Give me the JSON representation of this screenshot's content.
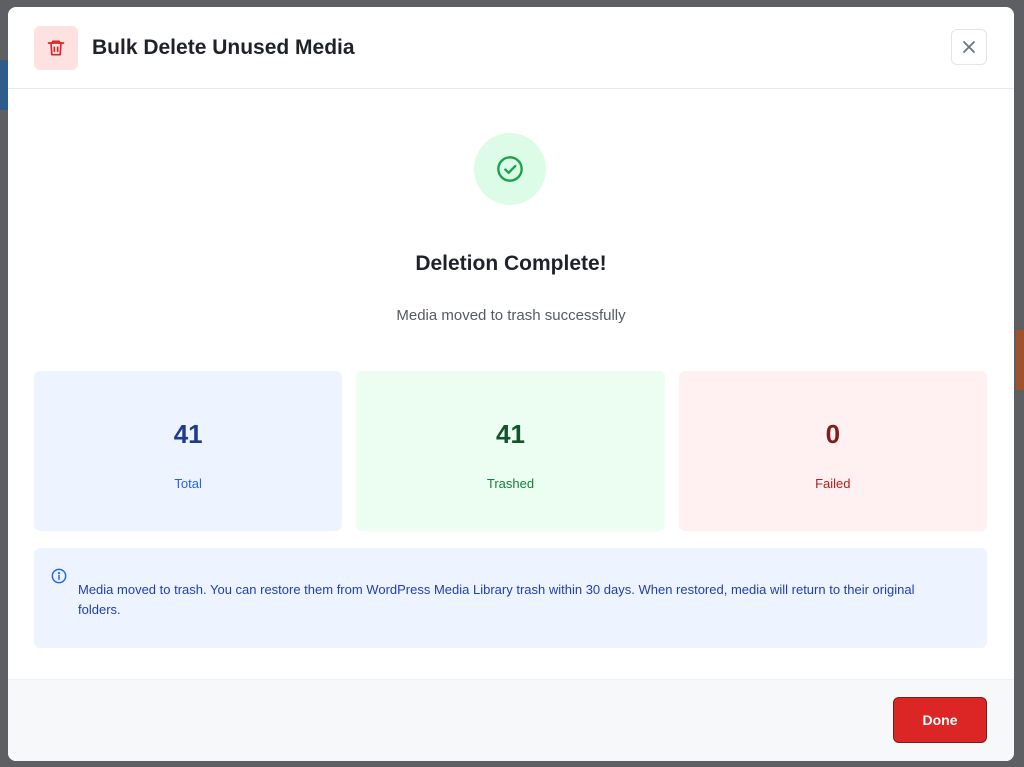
{
  "modal": {
    "title": "Bulk Delete Unused Media",
    "header_icon": "trash-icon",
    "close_icon": "close-icon"
  },
  "result": {
    "icon": "check-circle-icon",
    "title": "Deletion Complete!",
    "subtitle": "Media moved to trash successfully"
  },
  "stats": {
    "total": {
      "value": "41",
      "label": "Total"
    },
    "trashed": {
      "value": "41",
      "label": "Trashed"
    },
    "failed": {
      "value": "0",
      "label": "Failed"
    }
  },
  "info": {
    "icon": "info-icon",
    "text": "Media moved to trash. You can restore them from WordPress Media Library trash within 30 days. When restored, media will return to their original folders."
  },
  "footer": {
    "done_label": "Done"
  },
  "colors": {
    "danger": "#dc2626",
    "success": "#16a34a",
    "info": "#2563eb"
  }
}
